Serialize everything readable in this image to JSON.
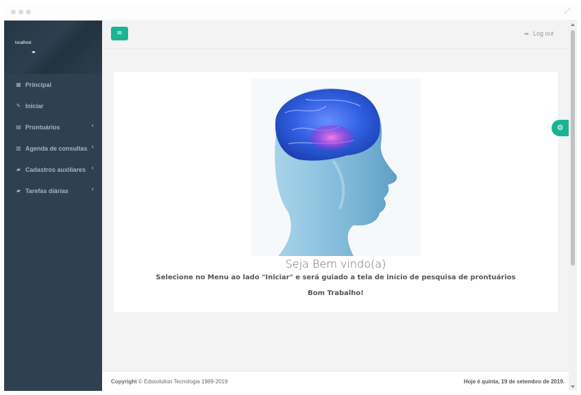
{
  "sidebar": {
    "host": "localhost",
    "items": [
      {
        "label": "Principal",
        "icon": "grid-icon",
        "glyph": "▦",
        "has_arrow": false
      },
      {
        "label": "Iniciar",
        "icon": "edit-icon",
        "glyph": "✎",
        "has_arrow": false
      },
      {
        "label": "Prontuários",
        "icon": "calculator-icon",
        "glyph": "▤",
        "has_arrow": true
      },
      {
        "label": "Agenda de consultas",
        "icon": "calendar-icon",
        "glyph": "▥",
        "has_arrow": true
      },
      {
        "label": "Cadastros auxiliares",
        "icon": "folder-open-icon",
        "glyph": "▰",
        "has_arrow": true
      },
      {
        "label": "Tarefas diárias",
        "icon": "folder-open-icon",
        "glyph": "▰",
        "has_arrow": true
      }
    ],
    "arrow_glyph": "‹"
  },
  "topbar": {
    "menu_glyph": "≡",
    "logout_label": "Log out",
    "logout_glyph": "➦"
  },
  "content": {
    "welcome": "Seja Bem vindo(a)",
    "instruction": "Selecione no Menu ao lado \"Iniciar\" e será guiado a tela de início de pesquisa de prontuários",
    "good_work": "Bom Trabalho!",
    "side_badge_glyph": "⚙"
  },
  "footer": {
    "copyright_label": "Copyright",
    "copyright_text": " © Edssolution Tecnologia 1989-2019",
    "date_text": "Hoje é quinta, 19 de setembro de 2019."
  },
  "colors": {
    "sidebar": "#2f4050",
    "accent": "#1ab394",
    "page_bg": "#f3f3f4"
  }
}
